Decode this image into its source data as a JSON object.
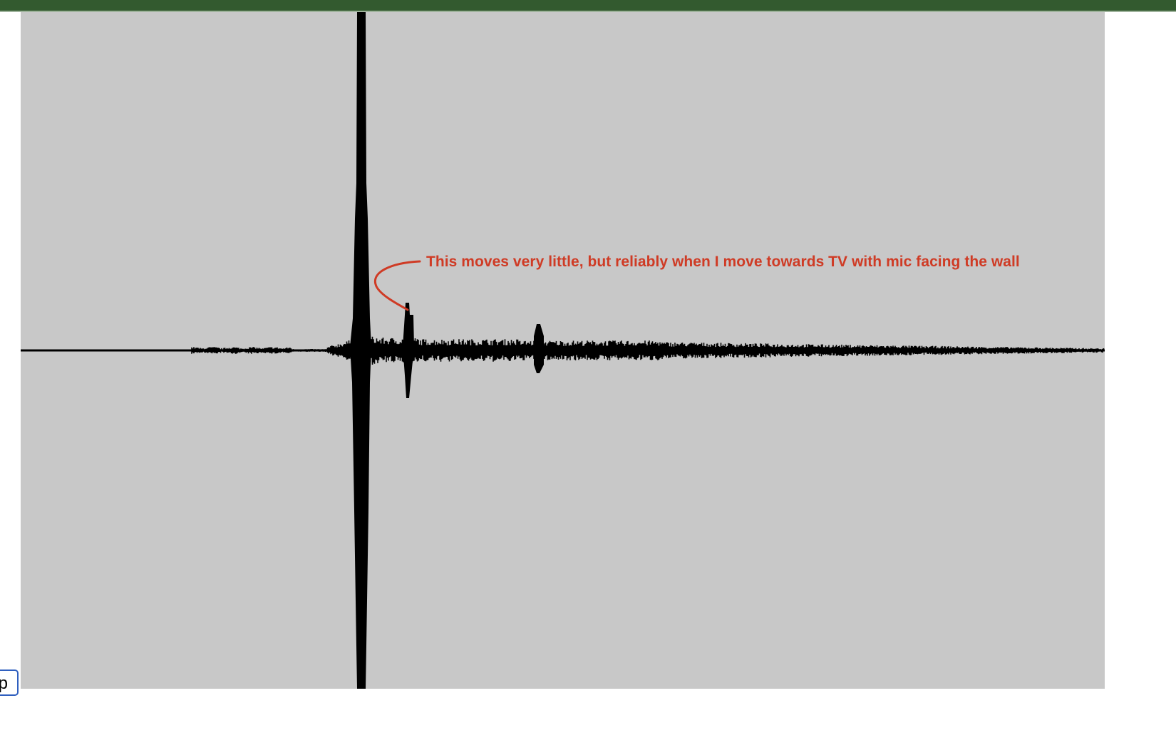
{
  "annotation": {
    "text": "This moves very little, but reliably when I move towards TV with mic facing the wall",
    "color": "#cf3b25"
  },
  "side_button": {
    "label": "p",
    "border_color": "#2f5fbf"
  },
  "colors": {
    "header": "#335a2f",
    "panel_background": "#c8c8c8",
    "waveform": "#000000"
  }
}
